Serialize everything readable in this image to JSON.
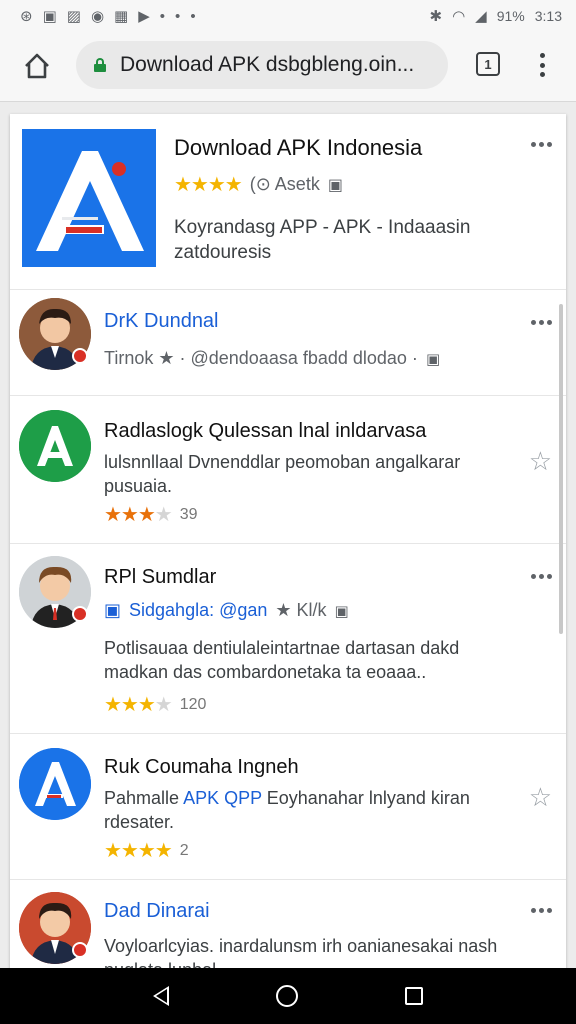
{
  "status_bar": {
    "left_icons": [
      "notification-icon",
      "photo-icon",
      "gallery-icon",
      "messenger-icon",
      "game-icon",
      "play-icon",
      "dot-icon",
      "dot-icon",
      "dot-icon"
    ],
    "battery_text": "91%",
    "time": "3:13"
  },
  "browser": {
    "url": "Download APK dsbgbleng.oin...",
    "tabs_count": "1"
  },
  "app_header": {
    "title": "Download APK Indonesia",
    "stars": "★★★★",
    "rating_extra": "(⊙ Asetk",
    "description": "Koyrandasg APP - APK - Indaaasin zatdouresis"
  },
  "items": [
    {
      "title": "DrK Dundnal",
      "sub": "Tirnok ★ · @dendoaasa fbadd dlodao ·",
      "avatar": "man-avatar"
    },
    {
      "title": "Radlaslogk Qulessan lnal inldarvasa",
      "desc": "lulsnnllaal  Dvnenddlar peomoban angalkarar pusuaia.",
      "stars": "★★★",
      "rating_count": "39",
      "avatar": "app-a-green"
    },
    {
      "title": "RPl Sumdlar",
      "sub_prefix": "Sidgahgla: @gan",
      "sub_suffix": "★ Kl/k",
      "desc": "Potlisauaa dentiulaleintartnae dartasan dakd madkan das combardonetaka ta eoaaa..",
      "stars": "★★★",
      "rating_count": "120",
      "avatar": "man-avatar-2"
    },
    {
      "title": "Ruk Coumaha Ingneh",
      "desc_pre": "Pahmalle ",
      "desc_blue": "APK QPP",
      "desc_post": " Eoyhanahar lnlyand kiran rdesater.",
      "stars": "★★★★",
      "rating_count": "2",
      "avatar": "app-a-blue"
    },
    {
      "title": "Dad Dinarai",
      "desc": "Voyloarlcyias. inardalunsm irh oanianesakai nash nuglata lunbal",
      "avatar": "man-avatar-3"
    }
  ],
  "colors": {
    "accent_blue": "#1a73e8",
    "green": "#1e8e3e",
    "star": "#f4b400"
  }
}
